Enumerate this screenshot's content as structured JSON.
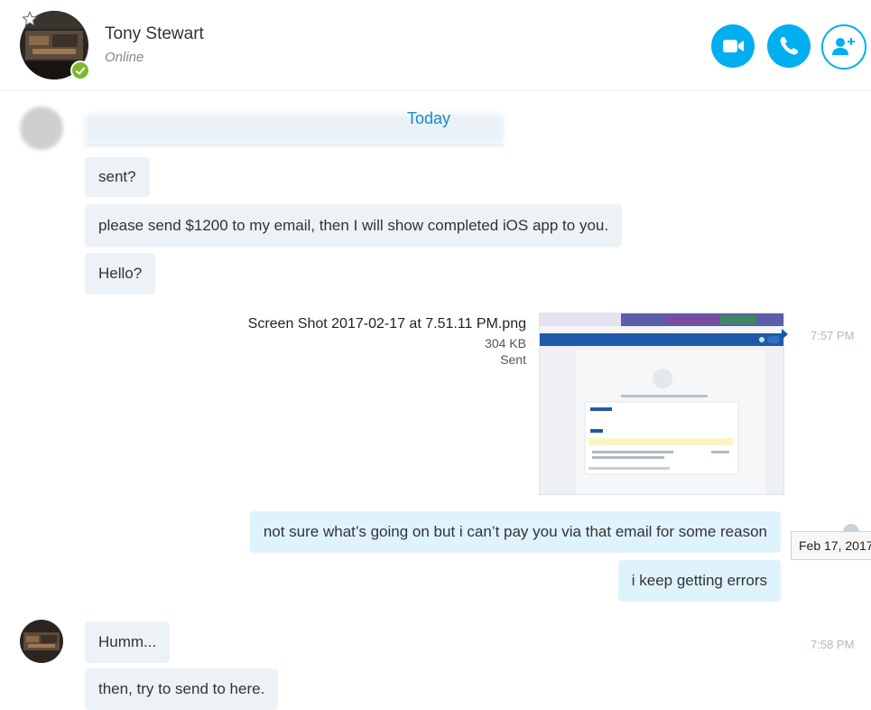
{
  "header": {
    "contact_name": "Tony Stewart",
    "status": "Online",
    "buttons": {
      "video": "video-call",
      "call": "audio-call",
      "add": "add-people"
    }
  },
  "date_separator": "Today",
  "messages": [
    {
      "id": "m1",
      "direction": "in",
      "text": "sent?"
    },
    {
      "id": "m2",
      "direction": "in",
      "text": "please send $1200 to my email, then I will show completed iOS app to you."
    },
    {
      "id": "m3",
      "direction": "in",
      "text": "Hello?"
    },
    {
      "id": "m4",
      "direction": "out",
      "type": "file",
      "file_name": "Screen Shot 2017-02-17 at 7.51.11 PM.png",
      "file_size": "304 KB",
      "file_status": "Sent",
      "time": "7:57 PM"
    },
    {
      "id": "m5",
      "direction": "out",
      "text": "not sure what’s going on but i can’t pay you via that email for some reason"
    },
    {
      "id": "m6",
      "direction": "out",
      "text": "i keep getting errors"
    },
    {
      "id": "m7",
      "direction": "in",
      "text": "Humm...",
      "time": "7:58 PM"
    },
    {
      "id": "m8",
      "direction": "in",
      "text": "then, try to send to here."
    }
  ],
  "tooltip": "Feb 17, 2017",
  "colors": {
    "accent": "#00aff0",
    "online": "#7cb92f",
    "incoming_bubble": "#edf2f7",
    "outgoing_bubble": "#dff3fd",
    "date_separator": "#1a8ad0"
  },
  "icons": [
    "star-icon",
    "video-camera-icon",
    "phone-icon",
    "add-person-icon",
    "presence-check-icon"
  ]
}
